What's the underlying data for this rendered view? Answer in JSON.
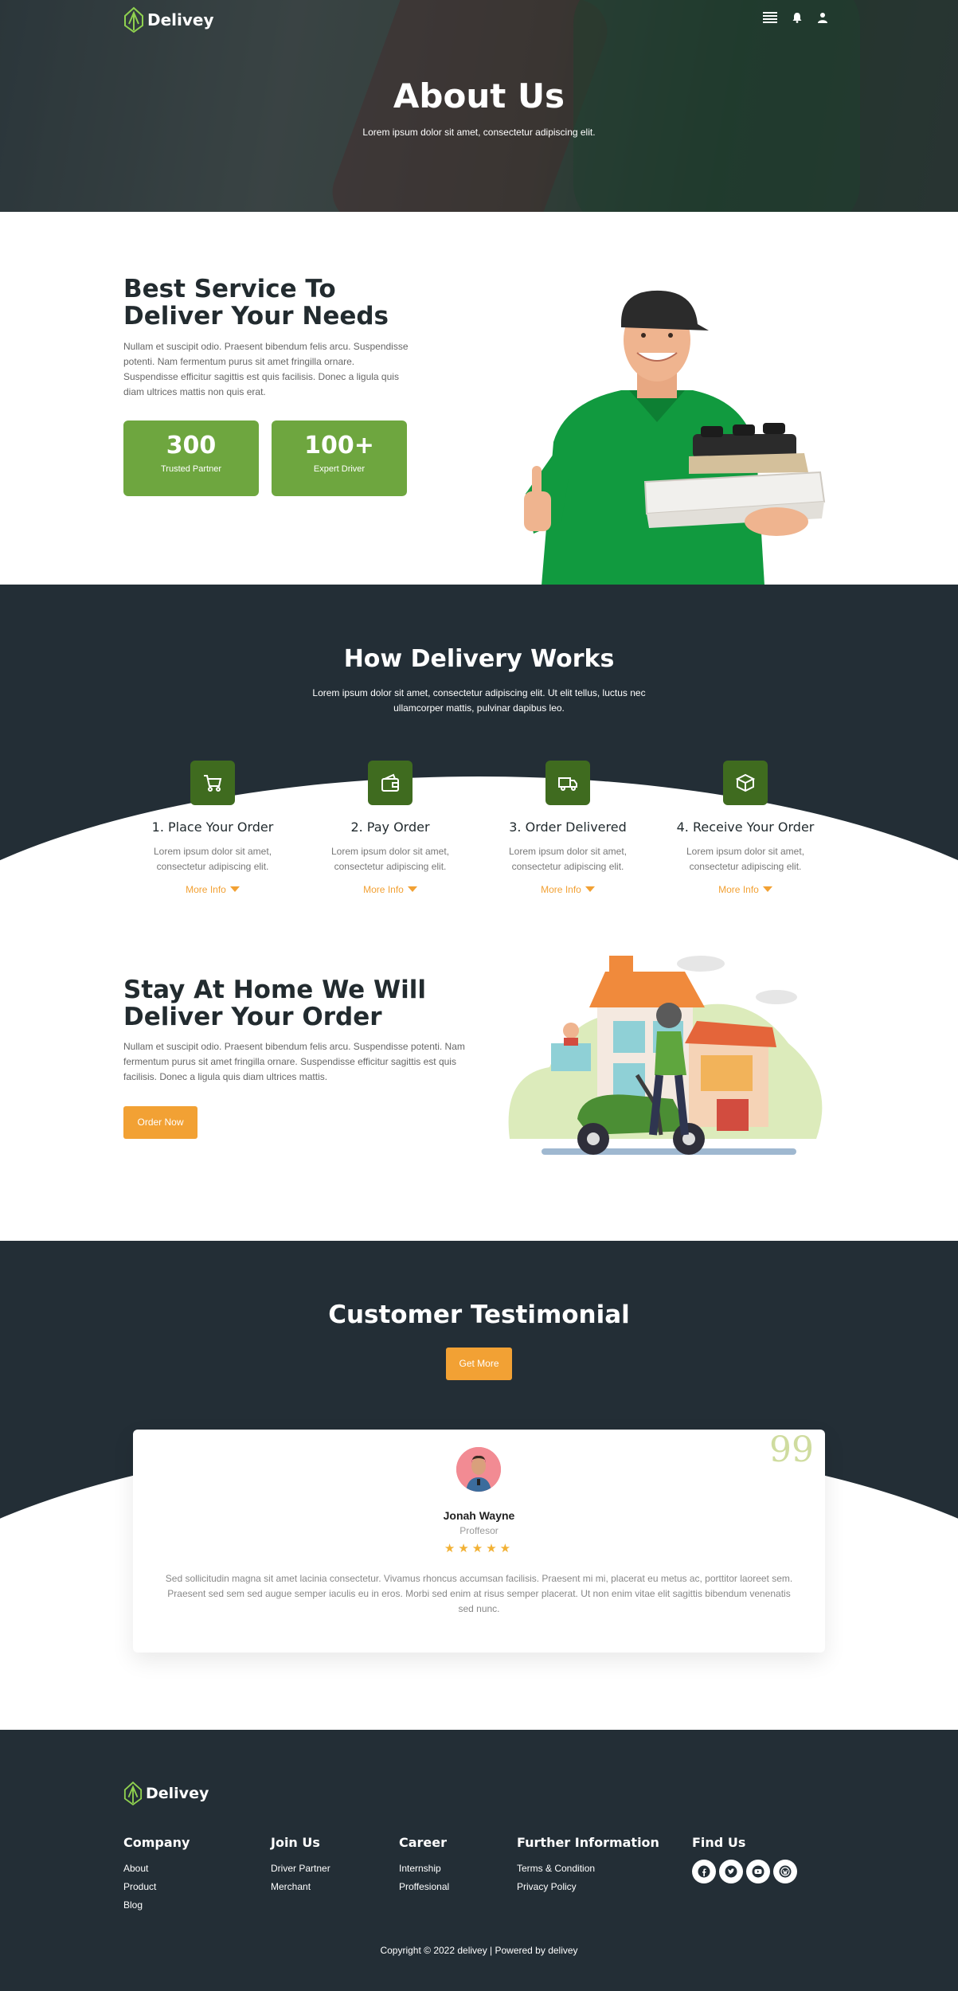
{
  "brand": {
    "name": "Delivey"
  },
  "hero": {
    "title": "About Us",
    "subtitle": "Lorem ipsum dolor sit amet, consectetur adipiscing elit."
  },
  "about": {
    "title": "Best Service To Deliver Your Needs",
    "text": "Nullam et suscipit odio. Praesent bibendum felis arcu. Suspendisse potenti. Nam fermentum purus sit amet fringilla ornare. Suspendisse efficitur sagittis est quis facilisis. Donec a ligula quis diam ultrices mattis non quis erat.",
    "stats": [
      {
        "value": "300",
        "label": "Trusted Partner"
      },
      {
        "value": "100+",
        "label": "Expert Driver"
      }
    ]
  },
  "how": {
    "title": "How Delivery Works",
    "subtitle": "Lorem ipsum dolor sit amet, consectetur adipiscing elit. Ut elit tellus, luctus nec ullamcorper mattis, pulvinar dapibus leo.",
    "steps": [
      {
        "title": "1. Place Your Order",
        "text": "Lorem ipsum dolor sit amet, consectetur adipiscing elit.",
        "more": "More Info",
        "icon": "cart-icon"
      },
      {
        "title": "2. Pay Order",
        "text": "Lorem ipsum dolor sit amet, consectetur adipiscing elit.",
        "more": "More Info",
        "icon": "wallet-icon"
      },
      {
        "title": "3. Order Delivered",
        "text": "Lorem ipsum dolor sit amet, consectetur adipiscing elit.",
        "more": "More Info",
        "icon": "truck-icon"
      },
      {
        "title": "4. Receive Your Order",
        "text": "Lorem ipsum dolor sit amet, consectetur adipiscing elit.",
        "more": "More Info",
        "icon": "box-icon"
      }
    ]
  },
  "stay": {
    "title": "Stay At Home We Will Deliver Your Order",
    "text": "Nullam et suscipit odio. Praesent bibendum felis arcu. Suspendisse potenti. Nam fermentum purus sit amet fringilla ornare. Suspendisse efficitur sagittis est quis facilisis. Donec a ligula quis diam ultrices mattis.",
    "button": "Order Now"
  },
  "testimonial": {
    "title": "Customer Testimonial",
    "button": "Get More",
    "name": "Jonah Wayne",
    "role": "Proffesor",
    "stars": "★★★★★",
    "quote": "99",
    "text": "Sed sollicitudin magna sit amet lacinia consectetur. Vivamus rhoncus accumsan facilisis. Praesent mi mi, placerat eu metus ac, porttitor laoreet sem. Praesent sed sem sed augue semper iaculis eu in eros. Morbi sed enim at risus semper placerat. Ut non enim vitae elit sagittis bibendum venenatis sed nunc."
  },
  "footer": {
    "company": {
      "title": "Company",
      "links": [
        "About",
        "Product",
        "Blog"
      ]
    },
    "join": {
      "title": "Join Us",
      "links": [
        "Driver Partner",
        "Merchant"
      ]
    },
    "career": {
      "title": "Career",
      "links": [
        "Internship",
        "Proffesional"
      ]
    },
    "further": {
      "title": "Further Information",
      "links": [
        "Terms & Condition",
        "Privacy Policy"
      ]
    },
    "find": {
      "title": "Find Us",
      "socials": [
        "facebook-icon",
        "twitter-icon",
        "youtube-icon",
        "wordpress-icon"
      ]
    },
    "copyright": "Copyright © 2022 delivey | Powered by delivey"
  },
  "colors": {
    "green": "#6ea63f",
    "dark_green": "#3f6b1f",
    "orange": "#f2a134",
    "navy": "#232e36"
  }
}
